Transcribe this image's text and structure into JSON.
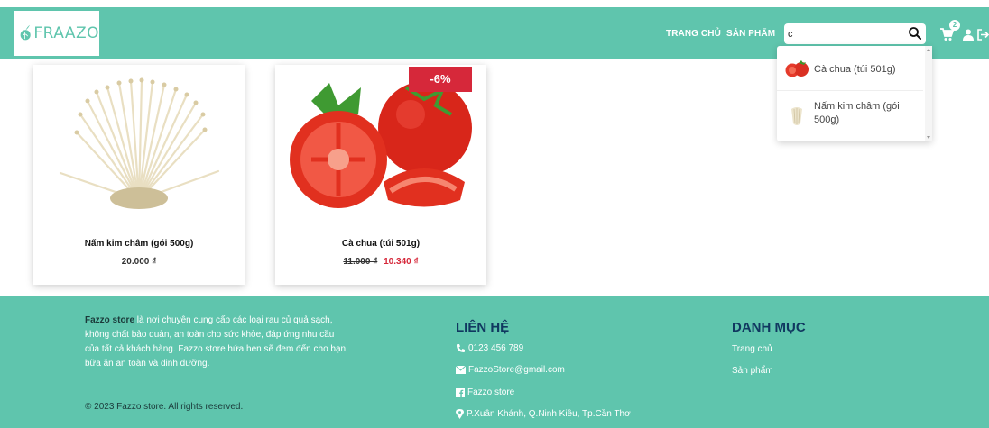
{
  "header": {
    "logo_text": "FRAAZO",
    "nav": {
      "home": "TRANG CHỦ",
      "products": "SẢN PHẨM"
    },
    "search": {
      "value": "c",
      "placeholder": ""
    },
    "cart_count": "2"
  },
  "search_results": [
    {
      "label": "Cà chua (túi 501g)",
      "thumb": "tomato"
    },
    {
      "label": "Nấm kim châm (gói 500g)",
      "thumb": "enoki-mushroom"
    }
  ],
  "products": [
    {
      "name": "Nấm kim châm (gói 500g)",
      "price": "20.000 ₫",
      "image": "enoki-mushroom"
    },
    {
      "name": "Cà chua (túi 501g)",
      "old_price": "11.000 ₫",
      "new_price": "10.340 ₫",
      "discount": "-6%",
      "image": "tomato"
    }
  ],
  "footer": {
    "about_brand": "Fazzo store",
    "about_text": " là nơi chuyên cung cấp các loại rau củ quả sạch, không chất bảo quản, an toàn cho sức khỏe, đáp ứng nhu cầu của tất cả khách hàng. Fazzo store hứa hẹn sẽ đem đến cho bạn bữa ăn an toàn và dinh dưỡng.",
    "copyright": "© 2023 Fazzo store. All rights reserved.",
    "contact_title": "LIÊN HỆ",
    "phone": "0123 456 789",
    "email": "FazzoStore@gmail.com",
    "facebook": "Fazzo store",
    "address": "P.Xuân Khánh, Q.Ninh Kiều, Tp.Cần Thơ",
    "menu_title": "DANH MỤC",
    "menu_links": [
      "Trang chủ",
      "Sản phẩm"
    ]
  },
  "colors": {
    "primary": "#5fc5ad",
    "sale": "#d6283a",
    "heading": "#103860"
  }
}
